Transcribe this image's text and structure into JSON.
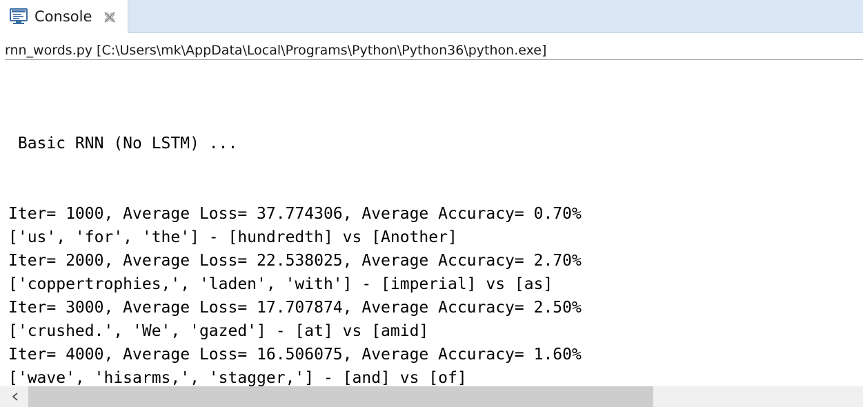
{
  "tab": {
    "title": "Console",
    "icon": "console-icon",
    "close_icon": "close-icon"
  },
  "process": {
    "label": "rnn_words.py [C:\\Users\\mk\\AppData\\Local\\Programs\\Python\\Python36\\python.exe]"
  },
  "output": {
    "lines": [
      " Basic RNN (No LSTM) ...",
      "Iter= 1000, Average Loss= 37.774306, Average Accuracy= 0.70%",
      "['us', 'for', 'the'] - [hundredth] vs [Another]",
      "Iter= 2000, Average Loss= 22.538025, Average Accuracy= 2.70%",
      "['coppertrophies,', 'laden', 'with'] - [imperial] vs [as]",
      "Iter= 3000, Average Loss= 17.707874, Average Accuracy= 2.50%",
      "['crushed.', 'We', 'gazed'] - [at] vs [amid]",
      "Iter= 4000, Average Loss= 16.506075, Average Accuracy= 1.60%",
      "['wave', 'hisarms,', 'stagger,'] - [and] vs [of]"
    ]
  },
  "scrollbar": {
    "left_icon": "chevron-left-icon"
  },
  "colors": {
    "tabbar_bg": "#dae6f3",
    "scrollbar_thumb": "#cdcdcd",
    "icon_blue": "#3a6ea5"
  }
}
